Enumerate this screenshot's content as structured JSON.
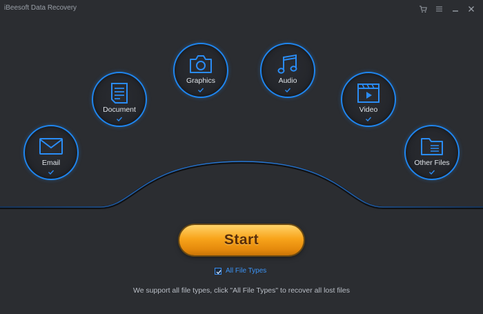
{
  "window": {
    "title": "iBeesoft Data Recovery",
    "controls": [
      "cart-icon",
      "menu-icon",
      "minimize-icon",
      "close-icon"
    ]
  },
  "file_types": [
    {
      "label": "Email",
      "icon": "email-icon",
      "checked": true
    },
    {
      "label": "Document",
      "icon": "document-icon",
      "checked": true
    },
    {
      "label": "Graphics",
      "icon": "camera-icon",
      "checked": true
    },
    {
      "label": "Audio",
      "icon": "music-note-icon",
      "checked": true
    },
    {
      "label": "Video",
      "icon": "video-icon",
      "checked": true
    },
    {
      "label": "Other Files",
      "icon": "folder-icon",
      "checked": true
    }
  ],
  "start": {
    "label": "Start"
  },
  "all_file_types": {
    "label": "All File Types",
    "checked": true
  },
  "support_text": "We support all file types, click \"All File Types\" to recover all lost files",
  "colors": {
    "accent": "#1f86f0",
    "background": "#2b2d31",
    "start": "#f8a41b"
  }
}
